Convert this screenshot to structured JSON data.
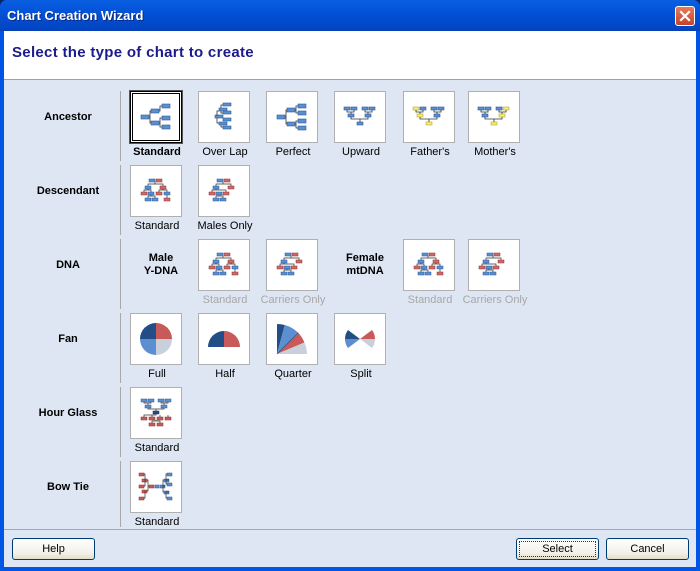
{
  "window": {
    "title": "Chart Creation Wizard",
    "close_icon": "close-icon"
  },
  "header": {
    "title": "Select the type of chart to create"
  },
  "rows": [
    {
      "label": "Ancestor",
      "items": [
        {
          "label": "Standard",
          "icon": "ancestor-standard-icon",
          "selected": true
        },
        {
          "label": "Over Lap",
          "icon": "ancestor-overlap-icon"
        },
        {
          "label": "Perfect",
          "icon": "ancestor-perfect-icon"
        },
        {
          "label": "Upward",
          "icon": "ancestor-upward-icon"
        },
        {
          "label": "Father's",
          "icon": "ancestor-fathers-icon"
        },
        {
          "label": "Mother's",
          "icon": "ancestor-mothers-icon"
        }
      ]
    },
    {
      "label": "Descendant",
      "items": [
        {
          "label": "Standard",
          "icon": "descendant-standard-icon"
        },
        {
          "label": "Males Only",
          "icon": "descendant-males-only-icon"
        }
      ]
    },
    {
      "label": "DNA",
      "groups": [
        {
          "label_line1": "Male",
          "label_line2": "Y-DNA",
          "items": [
            {
              "label": "Standard",
              "icon": "dna-male-standard-icon",
              "disabled": true
            },
            {
              "label": "Carriers Only",
              "icon": "dna-male-carriers-icon",
              "disabled": true
            }
          ]
        },
        {
          "label_line1": "Female",
          "label_line2": "mtDNA",
          "items": [
            {
              "label": "Standard",
              "icon": "dna-female-standard-icon",
              "disabled": true
            },
            {
              "label": "Carriers Only",
              "icon": "dna-female-carriers-icon",
              "disabled": true
            }
          ]
        }
      ]
    },
    {
      "label": "Fan",
      "items": [
        {
          "label": "Full",
          "icon": "fan-full-icon"
        },
        {
          "label": "Half",
          "icon": "fan-half-icon"
        },
        {
          "label": "Quarter",
          "icon": "fan-quarter-icon"
        },
        {
          "label": "Split",
          "icon": "fan-split-icon"
        }
      ]
    },
    {
      "label": "Hour Glass",
      "items": [
        {
          "label": "Standard",
          "icon": "hourglass-standard-icon"
        }
      ]
    },
    {
      "label": "Bow Tie",
      "items": [
        {
          "label": "Standard",
          "icon": "bowtie-standard-icon"
        }
      ]
    }
  ],
  "buttons": {
    "help": "Help",
    "select": "Select",
    "cancel": "Cancel"
  },
  "colors": {
    "title_text": "#1b1b8c",
    "male_blue": "#5b8fd0",
    "female_red": "#c85a5a",
    "highlight_yellow": "#f2ec7a",
    "dark_blue": "#234d86",
    "light_grey": "#c8d0dc"
  }
}
